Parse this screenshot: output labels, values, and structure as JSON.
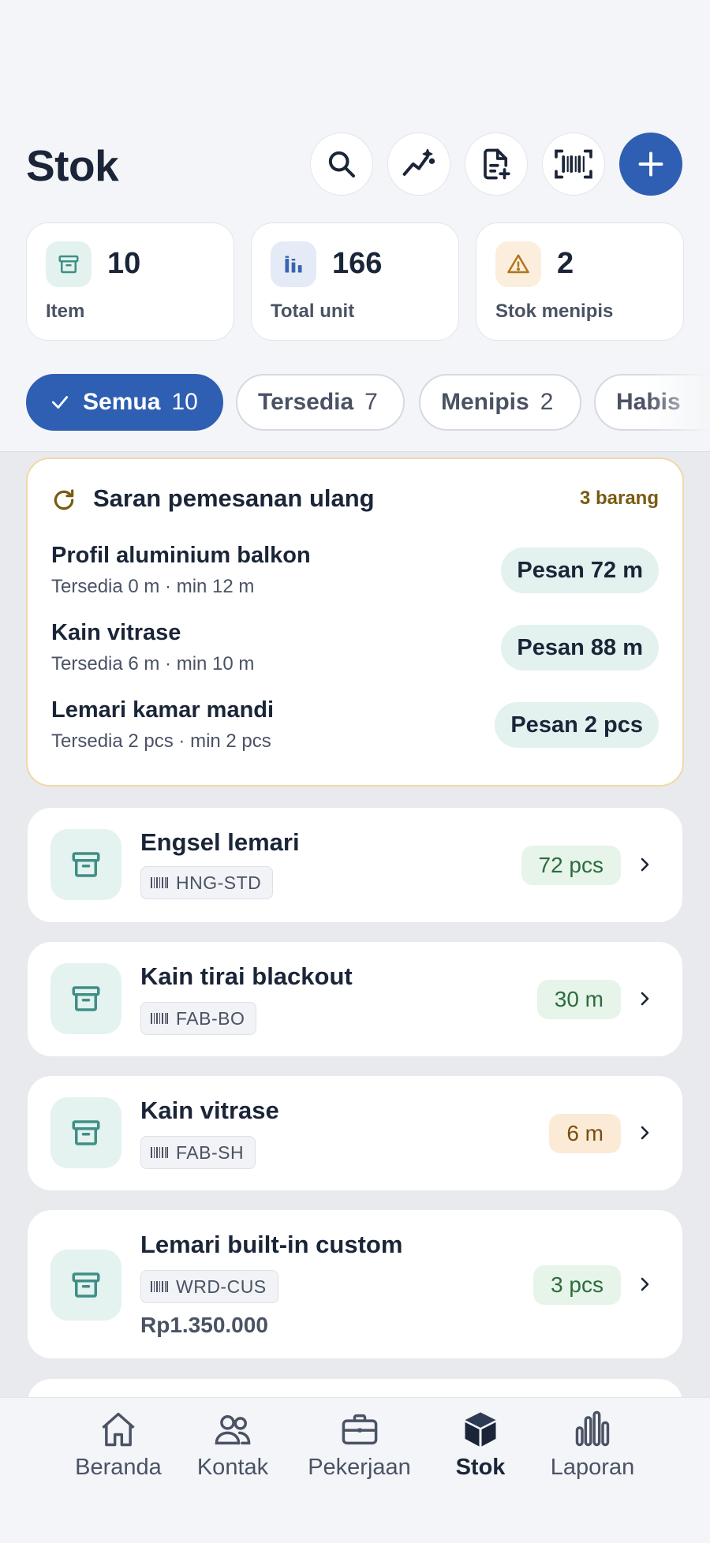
{
  "header": {
    "title": "Stok",
    "buttons": {
      "search": "search-icon",
      "insights": "sparkle-trend-icon",
      "import": "file-add-icon",
      "scan": "barcode-scan-icon",
      "add": "plus-icon"
    }
  },
  "stats": [
    {
      "value": "10",
      "label": "Item",
      "icon": "box-icon"
    },
    {
      "value": "166",
      "label": "Total unit",
      "icon": "bar-chart-icon"
    },
    {
      "value": "2",
      "label": "Stok menipis",
      "icon": "warning-icon"
    }
  ],
  "filters": [
    {
      "label": "Semua",
      "count": "10",
      "active": true
    },
    {
      "label": "Tersedia",
      "count": "7"
    },
    {
      "label": "Menipis",
      "count": "2"
    },
    {
      "label": "Habis",
      "count": ""
    }
  ],
  "reorder": {
    "title": "Saran pemesanan ulang",
    "count": "3 barang",
    "rows": [
      {
        "name": "Profil aluminium balkon",
        "sub": "Tersedia 0 m · min 12 m",
        "action": "Pesan 72 m"
      },
      {
        "name": "Kain vitrase",
        "sub": "Tersedia 6 m · min 10 m",
        "action": "Pesan 88 m"
      },
      {
        "name": "Lemari kamar mandi",
        "sub": "Tersedia 2 pcs · min 2 pcs",
        "action": "Pesan 2 pcs"
      }
    ]
  },
  "items": [
    {
      "name": "Engsel lemari",
      "sku": "HNG-STD",
      "qty": "72 pcs",
      "status": "ok"
    },
    {
      "name": "Kain tirai blackout",
      "sku": "FAB-BO",
      "qty": "30 m",
      "status": "ok"
    },
    {
      "name": "Kain vitrase",
      "sku": "FAB-SH",
      "qty": "6 m",
      "status": "low"
    },
    {
      "name": "Lemari built-in custom",
      "sku": "WRD-CUS",
      "qty": "3 pcs",
      "status": "ok",
      "price": "Rp1.350.000"
    }
  ],
  "nav": [
    {
      "label": "Beranda",
      "icon": "home-icon"
    },
    {
      "label": "Kontak",
      "icon": "users-icon"
    },
    {
      "label": "Pekerjaan",
      "icon": "briefcase-icon"
    },
    {
      "label": "Stok",
      "icon": "cube-icon",
      "active": true
    },
    {
      "label": "Laporan",
      "icon": "chart-icon"
    }
  ],
  "colors": {
    "primary": "#2F5FB3",
    "ok": "#E6F4E9",
    "low": "#FBEBD6",
    "reorder_border": "#F0D9A8"
  }
}
